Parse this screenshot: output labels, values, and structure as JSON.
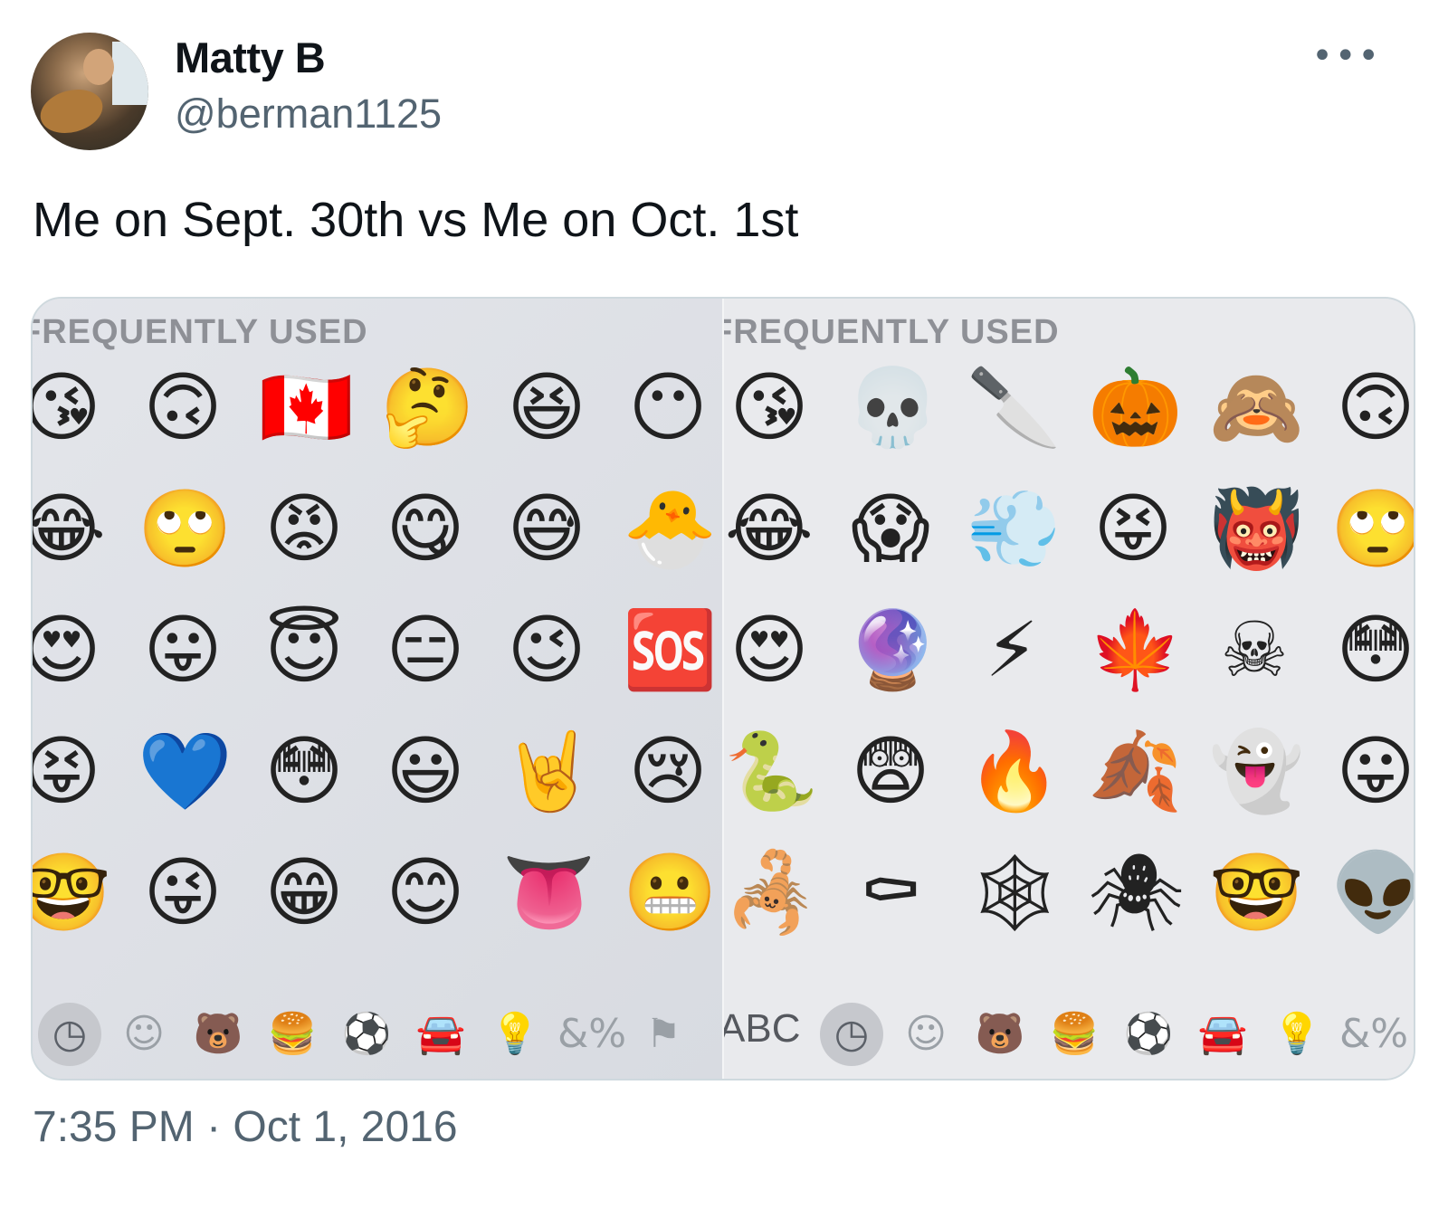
{
  "author": {
    "display_name": "Matty B",
    "handle": "@berman1125",
    "more_label": "•••"
  },
  "tweet": {
    "text": "Me on Sept. 30th vs Me on Oct. 1st",
    "timestamp": "7:35 PM · Oct 1, 2016"
  },
  "media": {
    "left": {
      "section_title": "FREQUENTLY USED",
      "rows": [
        [
          "😘",
          "🙃",
          "🇨🇦",
          "🤔",
          "😆",
          "😶"
        ],
        [
          "😂",
          "🙄",
          "😡",
          "😋",
          "😅",
          "🐣"
        ],
        [
          "😍",
          "😛",
          "😇",
          "😑",
          "😉",
          "🆘"
        ],
        [
          "😝",
          "💙",
          "😳",
          "😃",
          "🤘",
          "😢"
        ],
        [
          "🤓",
          "😜",
          "😁",
          "😊",
          "👅",
          "😬"
        ]
      ],
      "toolbar": [
        "◷",
        "☺",
        "🐻",
        "🍔",
        "⚽",
        "🚘",
        "💡",
        "&%",
        "⚑"
      ]
    },
    "right": {
      "section_title": "FREQUENTLY USED",
      "rows": [
        [
          "😘",
          "💀",
          "🔪",
          "🎃",
          "🙈",
          "🙃"
        ],
        [
          "😂",
          "😱",
          "💨",
          "😝",
          "👹",
          "🙄"
        ],
        [
          "😍",
          "🔮",
          "⚡",
          "🍁",
          "☠",
          "😳"
        ],
        [
          "🐍",
          "😨",
          "🔥",
          "🍂",
          "👻",
          "😛"
        ],
        [
          "🦂",
          "⚰",
          "🕸",
          "🕷",
          "🤓",
          "👽"
        ]
      ],
      "abc_label": "ABC",
      "toolbar": [
        "◷",
        "☺",
        "🐻",
        "🍔",
        "⚽",
        "🚘",
        "💡",
        "&%"
      ]
    }
  }
}
